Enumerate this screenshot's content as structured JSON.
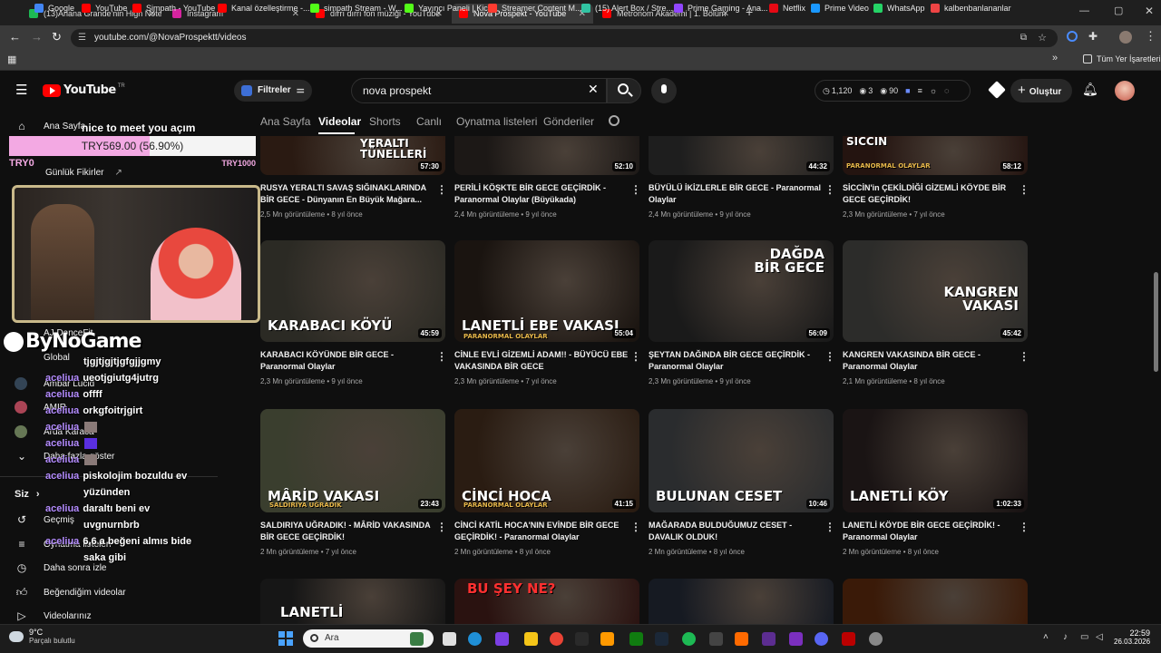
{
  "tabs": [
    {
      "label": "(13)Ariana Grande'nin High Notes",
      "color": "#1db954"
    },
    {
      "label": "Instagram",
      "color": "#d6249f"
    },
    {
      "label": "dırrı dırrı fon müziği - YouTube",
      "color": "#ff0000"
    },
    {
      "label": "Nova Prospekt - YouTube",
      "color": "#ff0000"
    },
    {
      "label": "Metronom Akademi | 1. Bölüm",
      "color": "#ff0000"
    }
  ],
  "url": "youtube.com/@NovaProspektt/videos",
  "bookmarks": [
    {
      "label": "Google",
      "color": "#4285f4"
    },
    {
      "label": "YouTube",
      "color": "#ff0000"
    },
    {
      "label": "Simpath - YouTube",
      "color": "#ff0000"
    },
    {
      "label": "Kanal özelleştirme -...",
      "color": "#ff0000"
    },
    {
      "label": "simpath Stream - W...",
      "color": "#53fc18"
    },
    {
      "label": "Yayıncı Paneli | Kick",
      "color": "#53fc18"
    },
    {
      "label": "Streamer Content M...",
      "color": "#ff3b30"
    },
    {
      "label": "(15) Alert Box / Stre...",
      "color": "#31c3a2"
    },
    {
      "label": "Prime Gaming - Ana...",
      "color": "#9146ff"
    },
    {
      "label": "Netflix",
      "color": "#e50914"
    },
    {
      "label": "Prime Video",
      "color": "#1a98ff"
    },
    {
      "label": "WhatsApp",
      "color": "#25d366"
    },
    {
      "label": "kalbenbanlananlar",
      "color": "#e44"
    }
  ],
  "all_bookmarks": "Tüm Yer İşaretleri",
  "yt": {
    "logo": "YouTube",
    "region": "TR",
    "filters": "Filtreler",
    "search": "nova prospekt",
    "stats": {
      "a": "1,120",
      "b": "3",
      "c": "90"
    },
    "create": "Oluştur"
  },
  "sidebar": {
    "home": "Ana Sayfa",
    "ideas": "Günlük Fikirler",
    "subs": [
      "AJ DanceFit",
      "Global",
      "Ambar Lucid",
      "AMIR",
      "Arda Karaca"
    ],
    "more": "Daha fazla göster",
    "you": "Siz",
    "history": "Geçmiş",
    "playlists": "Oynatma listeleri",
    "later": "Daha sonra izle",
    "liked": "Beğendiğim videolar",
    "yours": "Videolarınız"
  },
  "channel_tabs": [
    "Ana Sayfa",
    "Videolar",
    "Shorts",
    "Canlı",
    "Oynatma listeleri",
    "Gönderiler"
  ],
  "videos": [
    {
      "title": "RUSYA YERALTI SAVAŞ SIĞINAKLARINDA BİR GECE - Dünyanın En Büyük Mağara...",
      "views": "2,5 Mn görüntüleme",
      "age": "8 yıl önce",
      "dur": "57:30",
      "ovl": "YERALTI TÜNELLERİ",
      "bg": "#2a1a12"
    },
    {
      "title": "PERİLİ KÖŞKTE BİR GECE GEÇİRDİK - Paranormal Olaylar (Büyükada)",
      "views": "2,4 Mn görüntüleme",
      "age": "9 yıl önce",
      "dur": "52:10",
      "ovl": "",
      "bg": "#1c1816"
    },
    {
      "title": "BÜYÜLÜ İKİZLERLE BİR GECE - Paranormal Olaylar",
      "views": "2,4 Mn görüntüleme",
      "age": "9 yıl önce",
      "dur": "44:32",
      "ovl": "",
      "bg": "#1e1e1e"
    },
    {
      "title": "SİCCİN'in ÇEKİLDİĞİ GİZEMLİ KÖYDE BİR GECE GEÇİRDİK!",
      "views": "2,3 Mn görüntüleme",
      "age": "7 yıl önce",
      "dur": "58:12",
      "ovl": "SİCCİN",
      "sub": "PARANORMAL OLAYLAR",
      "bg": "#241410"
    },
    {
      "title": "KARABACI KÖYÜNDE BİR GECE - Paranormal Olaylar",
      "views": "2,3 Mn görüntüleme",
      "age": "9 yıl önce",
      "dur": "45:59",
      "ovl": "KARABACI KÖYÜ",
      "bg": "#2b2a24"
    },
    {
      "title": "CİNLE EVLİ GİZEMLİ ADAM!! - BÜYÜCÜ EBE VAKASINDA BİR GECE",
      "views": "2,3 Mn görüntüleme",
      "age": "7 yıl önce",
      "dur": "55:04",
      "ovl": "LANETLİ EBE VAKASI",
      "sub": "PARANORMAL OLAYLAR",
      "bg": "#1a1410"
    },
    {
      "title": "ŞEYTAN DAĞINDA BİR GECE GEÇİRDİK - Paranormal Olaylar",
      "views": "2,3 Mn görüntüleme",
      "age": "9 yıl önce",
      "dur": "56:09",
      "ovl": "DAĞDA BİR GECE",
      "bg": "#1a1a1a"
    },
    {
      "title": "KANGREN VAKASINDA BİR GECE - Paranormal Olaylar",
      "views": "2,1 Mn görüntüleme",
      "age": "8 yıl önce",
      "dur": "45:42",
      "ovl": "KANGREN VAKASI",
      "bg": "#2c2c2a"
    },
    {
      "title": "SALDIRIYA UĞRADIK! - MÂRİD VAKASINDA BİR GECE GEÇİRDİK!",
      "views": "2 Mn görüntüleme",
      "age": "7 yıl önce",
      "dur": "23:43",
      "ovl": "MÂRİD VAKASI",
      "sub": "SALDIRIYA UĞRADIK",
      "bg": "#3a3e2e"
    },
    {
      "title": "CİNCİ KATİL HOCA'NIN EVİNDE BİR GECE GEÇİRDİK! - Paranormal Olaylar",
      "views": "2 Mn görüntüleme",
      "age": "8 yıl önce",
      "dur": "41:15",
      "ovl": "CİNCİ HOCA",
      "sub": "PARANORMAL OLAYLAR",
      "bg": "#2a1c12"
    },
    {
      "title": "MAĞARADA BULDUĞUMUZ CESET - DAVALIK OLDUK!",
      "views": "2 Mn görüntüleme",
      "age": "8 yıl önce",
      "dur": "10:46",
      "ovl": "BULUNAN CESET",
      "bg": "#2a2c2e"
    },
    {
      "title": "LANETLİ KÖYDE BİR GECE GEÇİRDİK! - Paranormal Olaylar",
      "views": "2 Mn görüntüleme",
      "age": "8 yıl önce",
      "dur": "1:02:33",
      "ovl": "LANETLİ KÖY",
      "bg": "#1a1414"
    },
    {
      "title": "",
      "views": "",
      "age": "",
      "dur": "",
      "ovl": "LANETLİ",
      "bg": "#161616"
    },
    {
      "title": "",
      "views": "",
      "age": "",
      "dur": "",
      "ovl": "BU ŞEY NE?",
      "bg": "#2a1210"
    },
    {
      "title": "",
      "views": "",
      "age": "",
      "dur": "",
      "ovl": "",
      "bg": "#161a22"
    },
    {
      "title": "",
      "views": "",
      "age": "",
      "dur": "",
      "ovl": "",
      "bg": "#3a1a08"
    }
  ],
  "stream": {
    "goal_title": "nice to meet you açım",
    "goal_text": "TRY569.00 (56.90%)",
    "goal_progress": 0.569,
    "goal_min": "TRY0",
    "goal_max": "TRY1000",
    "brand": "ByNoGame",
    "chat": [
      {
        "user": "",
        "msg": "tjgjtjgjtjgfgjjgmy"
      },
      {
        "user": "aceliua",
        "msg": "ueotjgiutg4jutrg"
      },
      {
        "user": "aceliua",
        "msg": "offff"
      },
      {
        "user": "aceliua",
        "msg": "orkgfoitrjgirt"
      },
      {
        "user": "aceliua",
        "msg": ""
      },
      {
        "user": "aceliua",
        "msg": ""
      },
      {
        "user": "aceliua",
        "msg": ""
      },
      {
        "user": "aceliua",
        "msg": "piskolojim bozuldu ev"
      },
      {
        "user": "",
        "msg": "yüzünden"
      },
      {
        "user": "aceliua",
        "msg": "daraltı beni ev"
      },
      {
        "user": "",
        "msg": "uvgnurnbrb"
      },
      {
        "user": "aceliua",
        "msg": "6,6 a beğeni almıs bide"
      },
      {
        "user": "",
        "msg": "saka gibi"
      }
    ]
  },
  "taskbar": {
    "weather_temp": "9°C",
    "weather_text": "Parçalı bulutlu",
    "search": "Ara",
    "time": "22:59",
    "date": "26.03.2026"
  }
}
